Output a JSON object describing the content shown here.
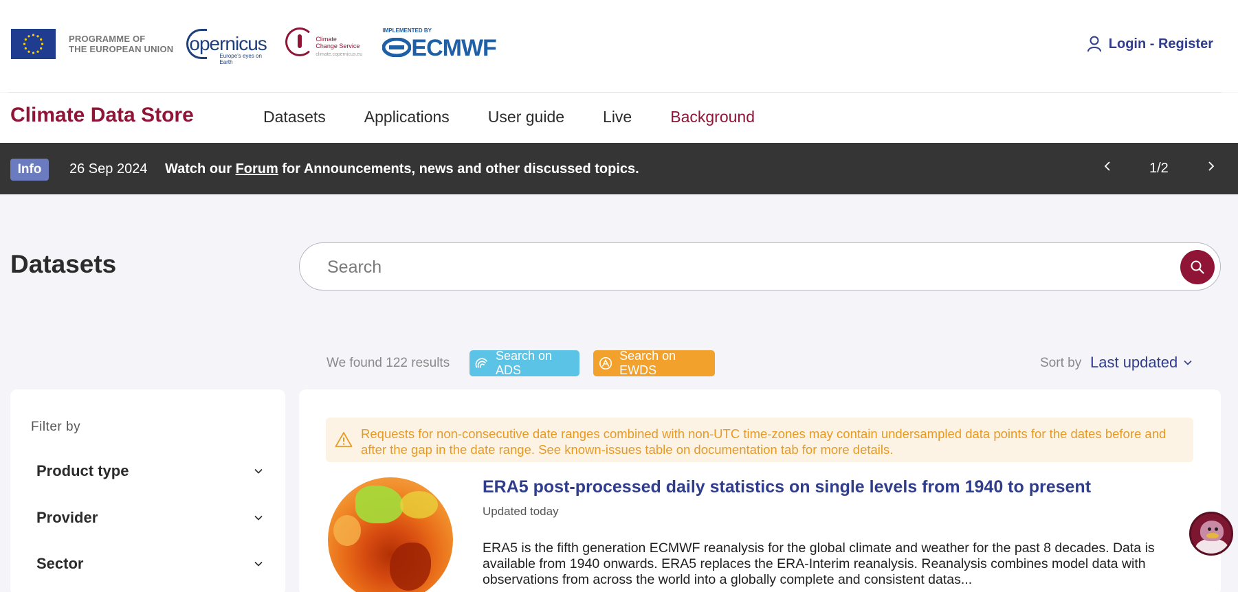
{
  "header": {
    "programme": [
      "PROGRAMME OF",
      "THE EUROPEAN UNION"
    ],
    "copernicus": {
      "name": "opernicus",
      "tagline": "Europe's eyes on Earth"
    },
    "c3s": {
      "line1": "Climate",
      "line2": "Change Service",
      "url": "climate.copernicus.eu"
    },
    "ecmwf": {
      "implemented": "IMPLEMENTED BY",
      "name": "ECMWF"
    },
    "login_label": "Login - Register"
  },
  "nav": {
    "brand": "Climate Data Store",
    "items": [
      {
        "label": "Datasets"
      },
      {
        "label": "Applications"
      },
      {
        "label": "User guide"
      },
      {
        "label": "Live"
      },
      {
        "label": "Background"
      }
    ]
  },
  "info": {
    "badge": "Info",
    "date": "26 Sep 2024",
    "msg_pre": "Watch our ",
    "msg_link": "Forum",
    "msg_post": " for Announcements, news and other discussed topics.",
    "pager": "1/2"
  },
  "main": {
    "title": "Datasets",
    "search_placeholder": "Search",
    "results": "We found 122 results",
    "ads_label": "Search on ADS",
    "ewds_label": "Search on EWDS",
    "sort_label": "Sort by",
    "sort_value": "Last updated"
  },
  "filters": {
    "title": "Filter by",
    "items": [
      {
        "label": "Product type"
      },
      {
        "label": "Provider"
      },
      {
        "label": "Sector"
      }
    ]
  },
  "warning": "Requests for non-consecutive date ranges combined with non-UTC time-zones may contain undersampled data points for the dates before and after the gap in the date range. See known-issues table on documentation tab for more details.",
  "dataset": {
    "title": "ERA5 post-processed daily statistics on single levels from 1940 to present",
    "updated": "Updated today",
    "description": "ERA5 is the fifth generation ECMWF reanalysis for the global climate and weather for the past 8 decades. Data is available from 1940 onwards. ERA5 replaces the ERA-Interim reanalysis. Reanalysis combines model data with observations from across the world into a globally complete and consistent datas..."
  },
  "colors": {
    "brand": "#8f1436",
    "link": "#2f3d8c",
    "info_bar": "#353535",
    "ads": "#5bc3e5",
    "ewds": "#f1a12c",
    "warning_text": "#e69a24"
  }
}
